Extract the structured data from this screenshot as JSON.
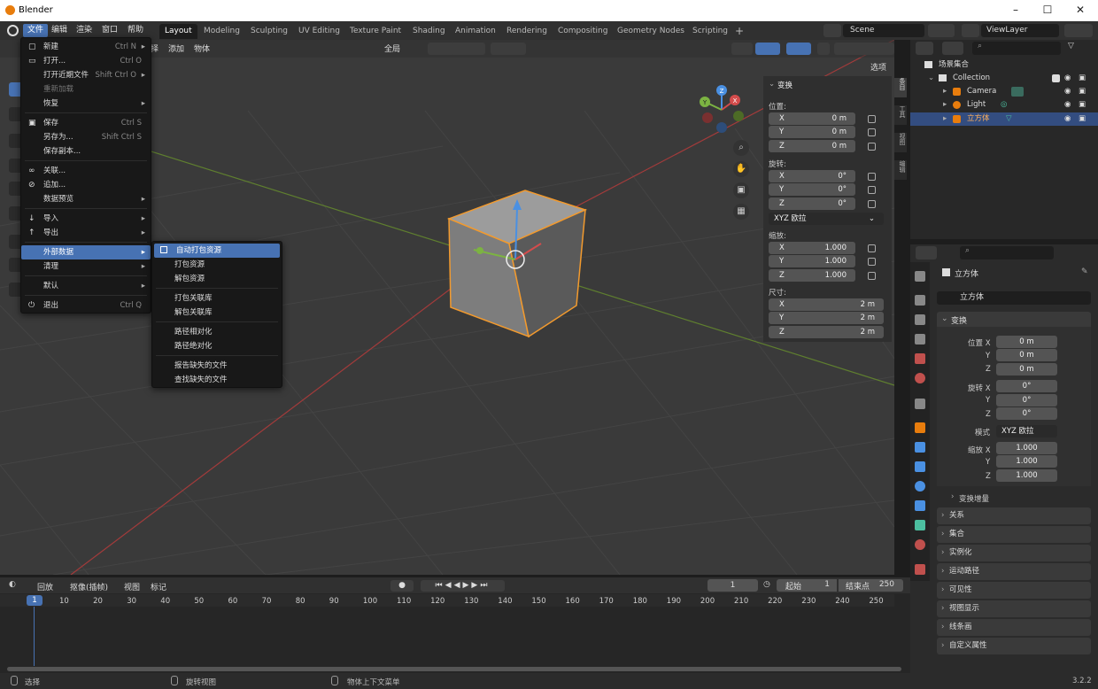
{
  "window": {
    "title": "Blender"
  },
  "topbar": {
    "menus": [
      "文件",
      "编辑",
      "渲染",
      "窗口",
      "帮助"
    ],
    "workspaces": [
      "Layout",
      "Modeling",
      "Sculpting",
      "UV Editing",
      "Texture Paint",
      "Shading",
      "Animation",
      "Rendering",
      "Compositing",
      "Geometry Nodes",
      "Scripting"
    ],
    "add_tab": "+",
    "scene": "Scene",
    "view_layer": "ViewLayer"
  },
  "viewport": {
    "menus": [
      "择",
      "添加",
      "物体"
    ],
    "transform_orientation": "全局",
    "options_label": "选项",
    "gizmo_axes": {
      "x": "X",
      "y": "Y",
      "z": "Z"
    }
  },
  "file_menu": {
    "items": [
      {
        "label": "新建",
        "shortcut": "Ctrl N",
        "arrow": "▸",
        "icon": "new-file-icon"
      },
      {
        "label": "打开...",
        "shortcut": "Ctrl O",
        "icon": "folder-icon"
      },
      {
        "label": "打开近期文件",
        "shortcut": "Shift Ctrl O",
        "arrow": "▸"
      },
      {
        "label": "重新加载",
        "disabled": true
      },
      {
        "label": "恢复",
        "arrow": "▸"
      },
      {
        "label": "保存",
        "shortcut": "Ctrl S",
        "icon": "save-icon"
      },
      {
        "label": "另存为...",
        "shortcut": "Shift Ctrl S"
      },
      {
        "label": "保存副本..."
      },
      {
        "label": "关联...",
        "icon": "link-icon"
      },
      {
        "label": "追加...",
        "icon": "append-icon"
      },
      {
        "label": "数据预览",
        "arrow": "▸"
      },
      {
        "label": "导入",
        "arrow": "▸",
        "icon": "import-icon"
      },
      {
        "label": "导出",
        "arrow": "▸",
        "icon": "export-icon"
      },
      {
        "label": "外部数据",
        "arrow": "▸",
        "highlight": true
      },
      {
        "label": "清理",
        "arrow": "▸"
      },
      {
        "label": "默认",
        "arrow": "▸"
      },
      {
        "label": "退出",
        "shortcut": "Ctrl Q",
        "icon": "power-icon"
      }
    ]
  },
  "external_data_menu": {
    "items": [
      "自动打包资源",
      "打包资源",
      "解包资源",
      "打包关联库",
      "解包关联库",
      "路径相对化",
      "路径绝对化",
      "报告缺失的文件",
      "查找缺失的文件"
    ]
  },
  "npanel": {
    "title": "变换",
    "location_label": "位置:",
    "location": {
      "x": "0 m",
      "y": "0 m",
      "z": "0 m"
    },
    "rotation_label": "旋转:",
    "rotation": {
      "x": "0°",
      "y": "0°",
      "z": "0°"
    },
    "rotation_mode": "XYZ 欧拉",
    "scale_label": "缩放:",
    "scale": {
      "x": "1.000",
      "y": "1.000",
      "z": "1.000"
    },
    "dimensions_label": "尺寸:",
    "dimensions": {
      "x": "2 m",
      "y": "2 m",
      "z": "2 m"
    },
    "axis": {
      "x": "X",
      "y": "Y",
      "z": "Z"
    },
    "side_tabs": [
      "条目",
      "工具",
      "视图",
      "编辑"
    ]
  },
  "outliner": {
    "root": "场景集合",
    "collection": "Collection",
    "objects": [
      "Camera",
      "Light",
      "立方体"
    ]
  },
  "properties": {
    "object_name": "立方体",
    "data_name": "立方体",
    "transform_title": "变换",
    "location_x_label": "位置 X",
    "rotation_x_label": "旋转 X",
    "scale_x_label": "缩放 X",
    "mode_label": "模式",
    "mode_value": "XYZ 欧拉",
    "y_label": "Y",
    "z_label": "Z",
    "location": [
      "0 m",
      "0 m",
      "0 m"
    ],
    "rotation": [
      "0°",
      "0°",
      "0°"
    ],
    "scale": [
      "1.000",
      "1.000",
      "1.000"
    ],
    "delta": "变换增量",
    "sections": [
      "关系",
      "集合",
      "实例化",
      "运动路径",
      "可见性",
      "视图显示",
      "线条画",
      "自定义属性"
    ]
  },
  "timeline": {
    "menus": [
      "回放",
      "抠像(插帧)",
      "视图",
      "标记"
    ],
    "current_frame": "1",
    "start_label": "起始",
    "start": "1",
    "end_label": "结束点",
    "end": "250",
    "ticks": [
      "10",
      "20",
      "30",
      "40",
      "50",
      "60",
      "70",
      "80",
      "90",
      "100",
      "110",
      "120",
      "130",
      "140",
      "150",
      "160",
      "170",
      "180",
      "190",
      "200",
      "210",
      "220",
      "230",
      "240",
      "250"
    ],
    "playhead": "1"
  },
  "status": {
    "select": "选择",
    "rotate": "旋转视图",
    "context": "物体上下文菜单",
    "version": "3.2.2"
  },
  "colors": {
    "accent": "#4772b3",
    "selection": "#e87d0d",
    "x_axis": "#d44c4c",
    "y_axis": "#7cb342",
    "z_axis": "#4a90e2"
  }
}
